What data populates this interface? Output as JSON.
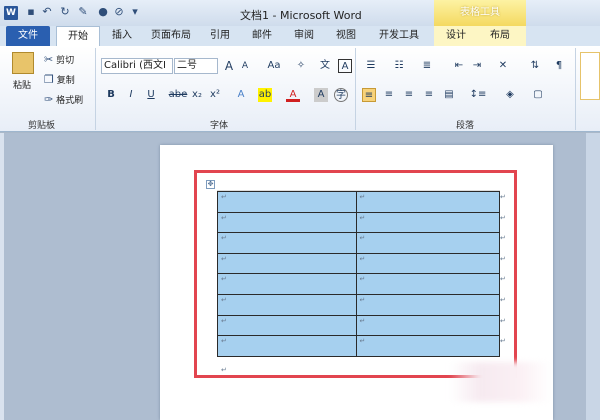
{
  "window": {
    "title": "文档1 - Microsoft Word",
    "contextual_group": "表格工具"
  },
  "quick_access": [
    "save-icon",
    "undo-icon",
    "redo-icon",
    "format-painter-icon",
    "color-icon",
    "clear-icon",
    "customize-icon"
  ],
  "tabs": [
    "文件",
    "开始",
    "插入",
    "页面布局",
    "引用",
    "邮件",
    "审阅",
    "视图",
    "开发工具",
    "设计",
    "布局"
  ],
  "clipboard": {
    "paste": "粘贴",
    "cut": "剪切",
    "copy": "复制",
    "format_painter": "格式刷",
    "group": "剪贴板"
  },
  "font": {
    "name": "Calibri (西文I",
    "size": "二号",
    "grow": "A",
    "shrink": "A",
    "case": "Aa",
    "bold": "B",
    "italic": "I",
    "underline": "U",
    "strike": "abe",
    "sub": "x₂",
    "sup": "x²",
    "group": "字体"
  },
  "paragraph": {
    "group": "段落"
  },
  "table": {
    "rows": 8,
    "cols": 2,
    "cell_mark": "↵"
  },
  "colors": {
    "accent": "#2a5fb0",
    "cell_fill": "#a6d0ef",
    "highlight": "#e2454f",
    "contextual": "#f4d960"
  }
}
